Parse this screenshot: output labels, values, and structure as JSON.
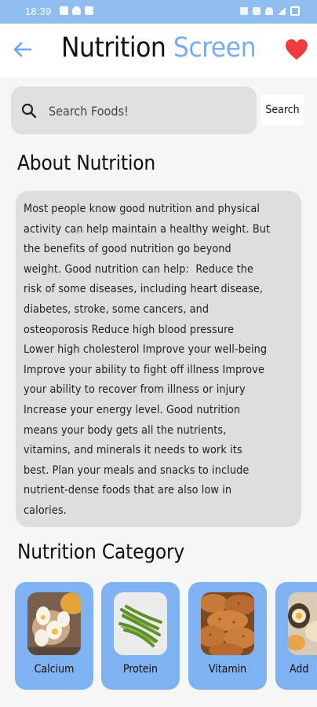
{
  "status_bar": {
    "time": "18:39"
  },
  "header": {
    "title_part1": "Nutrition",
    "title_part2": "Screen",
    "accent_color": "#78aef0",
    "favorite_color": "#ef3b3b"
  },
  "search": {
    "placeholder": "Search Foods!",
    "value": "",
    "button_label": "Search"
  },
  "about": {
    "heading": "About Nutrition",
    "text": "Most people know good nutrition and physical\nactivity can help maintain a healthy weight. But\nthe benefits of good nutrition go beyond\nweight. Good nutrition can help:  Reduce the\nrisk of some diseases, including heart disease,\ndiabetes, stroke, some cancers, and\nosteoporosis Reduce high blood pressure\nLower high cholesterol Improve your well-being\nImprove your ability to fight off illness Improve\nyour ability to recover from illness or injury\nIncrease your energy level. Good nutrition\nmeans your body gets all the nutrients,\nvitamins, and minerals it needs to work its\nbest. Plan your meals and snacks to include\nnutrient-dense foods that are also low in\ncalories."
  },
  "categories": {
    "heading": "Nutrition Category",
    "card_color": "#7fb2f1",
    "items": [
      {
        "label": "Calcium",
        "image": "boiled-eggs-image"
      },
      {
        "label": "Protein",
        "image": "green-beans-image"
      },
      {
        "label": "Vitamin",
        "image": "sweet-potatoes-image"
      },
      {
        "label": "Add",
        "image": "food-image"
      }
    ]
  }
}
